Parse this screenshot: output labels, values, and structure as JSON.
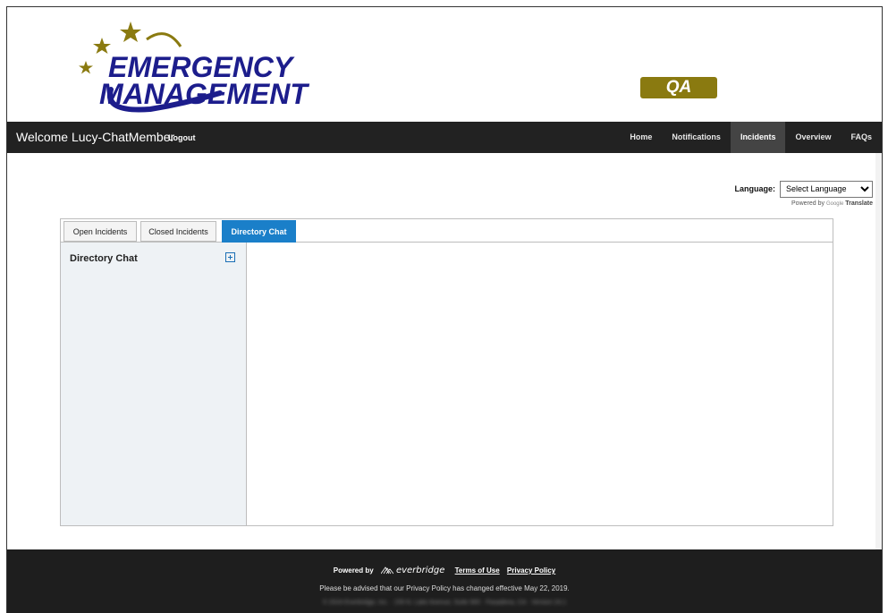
{
  "header": {
    "logo_line1": "EMERGENCY",
    "logo_line2": "MANAGEMENT",
    "env_badge": "QA"
  },
  "navbar": {
    "welcome": "Welcome Lucy-ChatMember",
    "logout": "Logout",
    "items": [
      {
        "label": "Home",
        "active": false
      },
      {
        "label": "Notifications",
        "active": false
      },
      {
        "label": "Incidents",
        "active": true
      },
      {
        "label": "Overview",
        "active": false
      },
      {
        "label": "FAQs",
        "active": false
      }
    ]
  },
  "language": {
    "label": "Language:",
    "selected": "Select Language",
    "powered_by": "Powered by",
    "google": "Google",
    "translate": "Translate"
  },
  "tabs": [
    {
      "label": "Open Incidents",
      "active": false
    },
    {
      "label": "Closed Incidents",
      "active": false
    },
    {
      "label": "Directory Chat",
      "active": true
    }
  ],
  "sidebar": {
    "title": "Directory Chat"
  },
  "footer": {
    "powered_by": "Powered by",
    "brand": "everbridge",
    "terms": "Terms of Use",
    "privacy": "Privacy Policy",
    "notice": "Please be advised that our Privacy Policy has changed effective May 22, 2019.",
    "blurred": "© 2024 Everbridge, Inc. · 155 N. Lake Avenue, Suite 900 · Pasadena, CA · Version 24.1"
  },
  "colors": {
    "navbar_bg": "#222222",
    "footer_bg": "#1e1e1e",
    "active_tab": "#1a7fc9",
    "badge": "#8a7a10",
    "logo_blue": "#1c1d8c",
    "logo_gold": "#8a7a10"
  }
}
